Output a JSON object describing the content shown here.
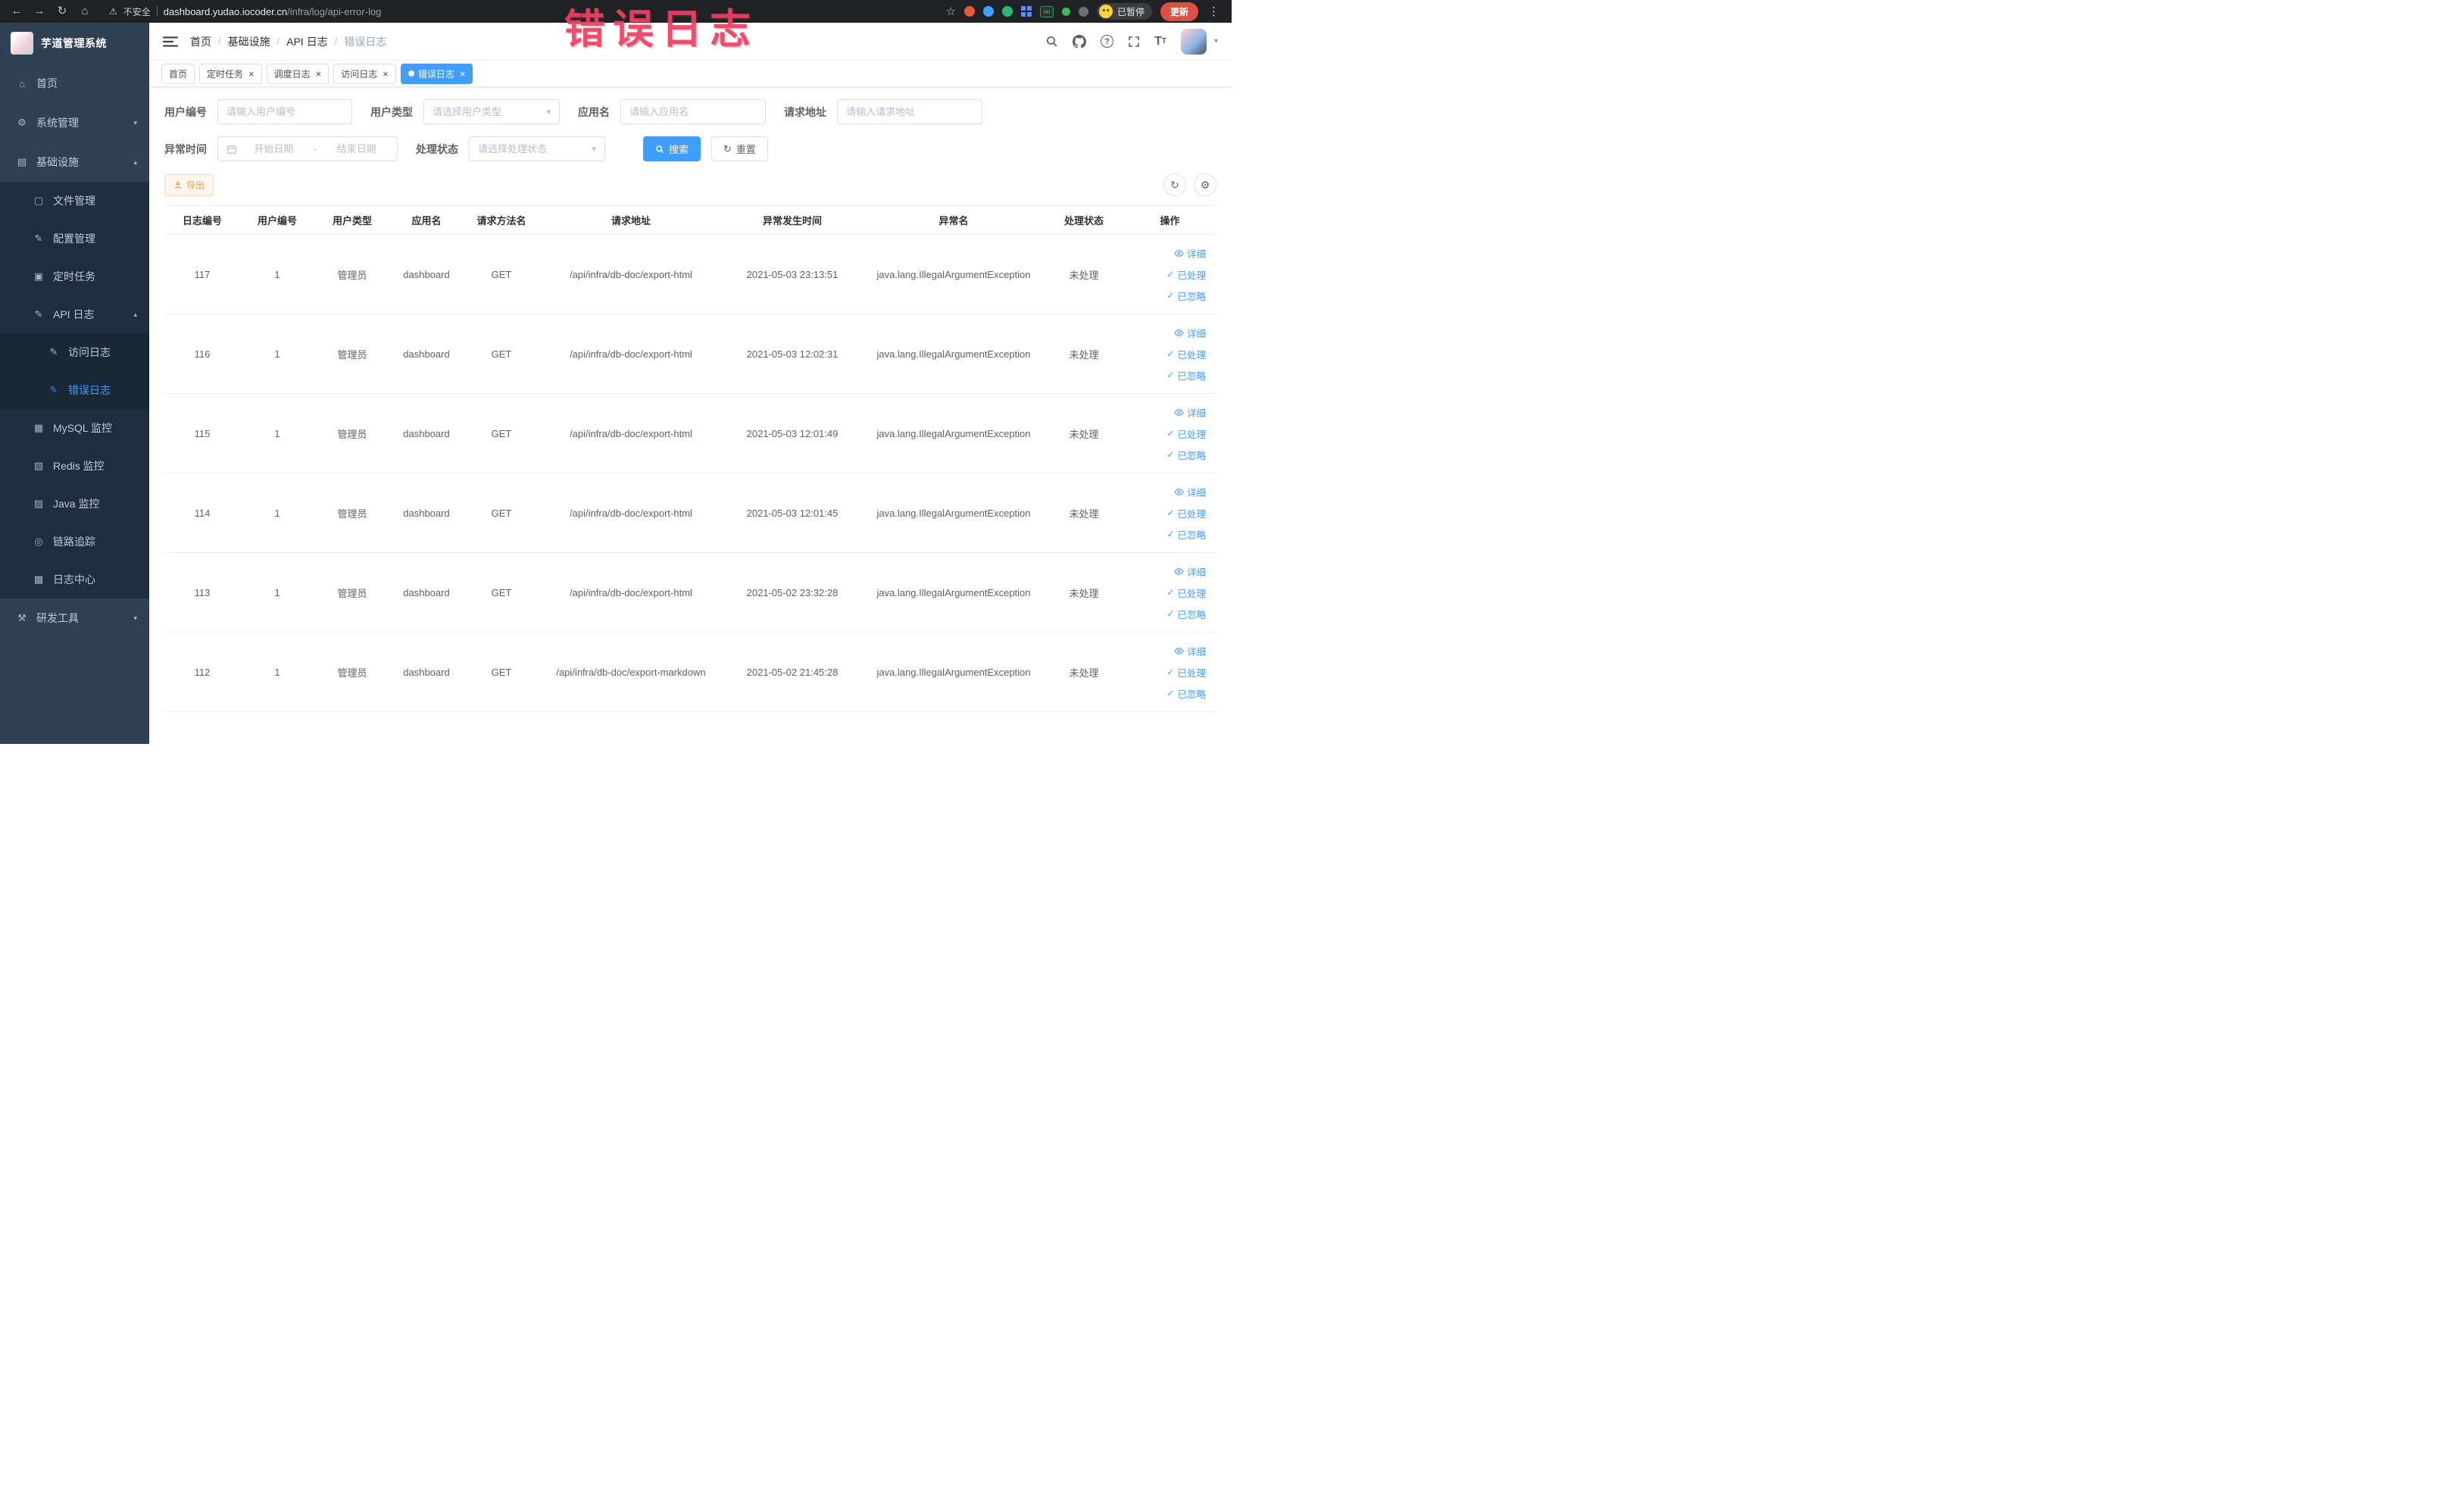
{
  "colors": {
    "primary": "#409eff",
    "sidebar_bg": "#304156",
    "submenu_bg": "#1f2d3d",
    "active_text": "#409eff",
    "warning": "#e6a23c",
    "annotation": "#f03e5f"
  },
  "annotation": {
    "text": "错误日志"
  },
  "browser": {
    "security_label": "不安全",
    "url_domain": "dashboard.yudao.iocoder.cn",
    "url_path": "/infra/log/api-error-log",
    "profile_badge": "已暂停",
    "update_button": "更新",
    "extension_on_label": "on"
  },
  "sidebar": {
    "logo_title": "芋道管理系统",
    "items": [
      {
        "key": "home",
        "label": "首页",
        "icon": "⌂",
        "level": 1
      },
      {
        "key": "system",
        "label": "系统管理",
        "icon": "⚙",
        "level": 1,
        "chevron": "down"
      },
      {
        "key": "infra",
        "label": "基础设施",
        "icon": "▤",
        "level": 1,
        "chevron": "up"
      },
      {
        "key": "file",
        "label": "文件管理",
        "icon": "▢",
        "level": 2
      },
      {
        "key": "config",
        "label": "配置管理",
        "icon": "✎",
        "level": 2
      },
      {
        "key": "job",
        "label": "定时任务",
        "icon": "▣",
        "level": 2
      },
      {
        "key": "api-log",
        "label": "API 日志",
        "icon": "✎",
        "level": 2,
        "chevron": "up"
      },
      {
        "key": "access-log",
        "label": "访问日志",
        "icon": "✎",
        "level": 3
      },
      {
        "key": "error-log",
        "label": "错误日志",
        "icon": "✎",
        "level": 3,
        "active": true
      },
      {
        "key": "mysql",
        "label": "MySQL 监控",
        "icon": "▦",
        "level": 2
      },
      {
        "key": "redis",
        "label": "Redis 监控",
        "icon": "▧",
        "level": 2
      },
      {
        "key": "java",
        "label": "Java 监控",
        "icon": "▨",
        "level": 2
      },
      {
        "key": "tracer",
        "label": "链路追踪",
        "icon": "◎",
        "level": 2
      },
      {
        "key": "log-center",
        "label": "日志中心",
        "icon": "▩",
        "level": 2
      },
      {
        "key": "dev-tools",
        "label": "研发工具",
        "icon": "⚒",
        "level": 1,
        "chevron": "down"
      }
    ]
  },
  "breadcrumb": [
    "首页",
    "基础设施",
    "API 日志",
    "错误日志"
  ],
  "tabs": [
    {
      "key": "home",
      "label": "首页",
      "closable": false,
      "active": false
    },
    {
      "key": "job",
      "label": "定时任务",
      "closable": true,
      "active": false
    },
    {
      "key": "job-log",
      "label": "调度日志",
      "closable": true,
      "active": false
    },
    {
      "key": "access-log",
      "label": "访问日志",
      "closable": true,
      "active": false
    },
    {
      "key": "error-log",
      "label": "错误日志",
      "closable": true,
      "active": true
    }
  ],
  "filters": {
    "user_id": {
      "label": "用户编号",
      "placeholder": "请输入用户编号"
    },
    "user_type": {
      "label": "用户类型",
      "placeholder": "请选择用户类型"
    },
    "app_name": {
      "label": "应用名",
      "placeholder": "请输入应用名"
    },
    "request_url": {
      "label": "请求地址",
      "placeholder": "请输入请求地址"
    },
    "exception_time": {
      "label": "异常时间",
      "start_placeholder": "开始日期",
      "separator": "-",
      "end_placeholder": "结束日期"
    },
    "process_status": {
      "label": "处理状态",
      "placeholder": "请选择处理状态"
    },
    "search_button": "搜索",
    "reset_button": "重置"
  },
  "toolbar": {
    "export_label": "导出"
  },
  "table": {
    "columns": [
      "日志编号",
      "用户编号",
      "用户类型",
      "应用名",
      "请求方法名",
      "请求地址",
      "异常发生时间",
      "异常名",
      "处理状态",
      "操作"
    ],
    "ops": {
      "detail": "详细",
      "processed": "已处理",
      "ignored": "已忽略"
    },
    "rows": [
      {
        "id": "117",
        "user_id": "1",
        "user_type": "管理员",
        "app_name": "dashboard",
        "method": "GET",
        "url": "/api/infra/db-doc/export-html",
        "time": "2021-05-03 23:13:51",
        "exception": "java.lang.IllegalArgumentException",
        "status": "未处理"
      },
      {
        "id": "116",
        "user_id": "1",
        "user_type": "管理员",
        "app_name": "dashboard",
        "method": "GET",
        "url": "/api/infra/db-doc/export-html",
        "time": "2021-05-03 12:02:31",
        "exception": "java.lang.IllegalArgumentException",
        "status": "未处理"
      },
      {
        "id": "115",
        "user_id": "1",
        "user_type": "管理员",
        "app_name": "dashboard",
        "method": "GET",
        "url": "/api/infra/db-doc/export-html",
        "time": "2021-05-03 12:01:49",
        "exception": "java.lang.IllegalArgumentException",
        "status": "未处理"
      },
      {
        "id": "114",
        "user_id": "1",
        "user_type": "管理员",
        "app_name": "dashboard",
        "method": "GET",
        "url": "/api/infra/db-doc/export-html",
        "time": "2021-05-03 12:01:45",
        "exception": "java.lang.IllegalArgumentException",
        "status": "未处理"
      },
      {
        "id": "113",
        "user_id": "1",
        "user_type": "管理员",
        "app_name": "dashboard",
        "method": "GET",
        "url": "/api/infra/db-doc/export-html",
        "time": "2021-05-02 23:32:28",
        "exception": "java.lang.IllegalArgumentException",
        "status": "未处理"
      },
      {
        "id": "112",
        "user_id": "1",
        "user_type": "管理员",
        "app_name": "dashboard",
        "method": "GET",
        "url": "/api/infra/db-doc/export-markdown",
        "time": "2021-05-02 21:45:28",
        "exception": "java.lang.IllegalArgumentException",
        "status": "未处理"
      }
    ]
  }
}
